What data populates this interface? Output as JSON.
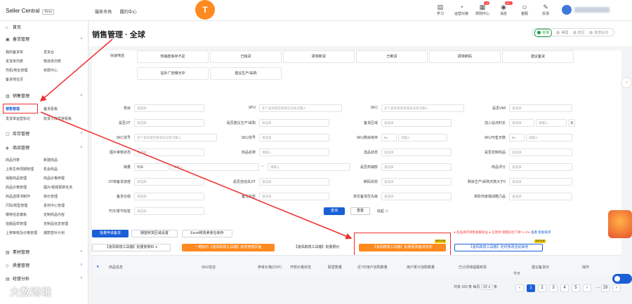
{
  "topbar": {
    "brand": "Seller Central",
    "beta": "Beta",
    "nav": [
      "服务市场",
      "履约中心"
    ],
    "logo_glyph": "T",
    "icons": [
      {
        "label": "学习",
        "icon": "book-icon",
        "glyph": "▤",
        "badge": ""
      },
      {
        "label": "运营对接",
        "icon": "headset-icon",
        "glyph": "◔",
        "badge": ""
      },
      {
        "label": "规则中心",
        "icon": "rules-icon",
        "glyph": "▦",
        "badge": "12"
      },
      {
        "label": "消息",
        "icon": "bell-icon",
        "glyph": "◉",
        "badge": "99+"
      },
      {
        "label": "客服",
        "icon": "service-icon",
        "glyph": "☺",
        "badge": ""
      },
      {
        "label": "反馈",
        "icon": "feedback-icon",
        "glyph": "✎",
        "badge": ""
      }
    ]
  },
  "sidebar": {
    "home": "首页",
    "groups": [
      {
        "label": "备货管理",
        "items": [
          "我的备货单",
          "发货台",
          "发货单列表",
          "物流单列表",
          "司机/地址管理",
          "权限中心",
          "备货地址页"
        ]
      },
      {
        "label": "销售管理",
        "items": [
          "销售管理",
          "备货看板",
          "发货单运营标记",
          "收货入库异常看板"
        ]
      },
      {
        "label": "库存管理",
        "items": []
      },
      {
        "label": "商品管理",
        "items": [
          "商品列表",
          "新建商品",
          "上新生命周期管理",
          "机会商品",
          "保税商品管理",
          "商品价格申报",
          "商品价格管理",
          "图片/视频更新任务",
          "商品选择书制作",
          "核价管理",
          "尺码/规型管理",
          "素材中心管理",
          "模特信息模板",
          "定制商品内容",
          "拍摄品样管理",
          "定制品信息管理",
          "上架审核及价格管理",
          "爆款替补计划"
        ]
      },
      {
        "label": "素材管理",
        "items": []
      },
      {
        "label": "质量管理",
        "items": []
      },
      {
        "label": "经营分析",
        "items": []
      }
    ]
  },
  "watermark": "大数跨境",
  "page": {
    "title": "销售管理 · 全球",
    "site_toggle": [
      "全球",
      "美国",
      "欧区",
      "其他站点"
    ]
  },
  "quick_filter": {
    "label": "快速筛选",
    "row1": [
      "热销款库存不足",
      "已缺货",
      "即将断货",
      "已断货",
      "即将断码",
      "建议备货"
    ],
    "row2": [
      "站外广告曝光中",
      "建议生产/采购"
    ]
  },
  "filters": {
    "row1": [
      {
        "label": "类目",
        "value": "请选择"
      },
      {
        "label": "SPU",
        "value": "多个查询请空格或逗号依次输入"
      },
      {
        "label": "SKC",
        "value": "多个查询请空格或逗号依次输入"
      },
      {
        "label": "是否VMI",
        "value": "请选择"
      }
    ],
    "row2": [
      {
        "label": "是否JIT",
        "value": "请选择"
      },
      {
        "label": "是否建议生产/采购",
        "value": "请选择"
      },
      {
        "label": "备货区域",
        "value": "请选择"
      },
      {
        "label": "加入站点时长",
        "value": "请选择",
        "extra": "请输入",
        "unit": "天"
      }
    ],
    "row3": [
      {
        "label": "SKC货号",
        "value": "多个查询请空格或逗号依次输入"
      },
      {
        "label": "SKU货号",
        "value": "请选择"
      },
      {
        "label": "SKU剩余库存",
        "prefix": "<=",
        "value": "请输入"
      },
      {
        "label": "SKU可售天数",
        "prefix": "<=",
        "value": "请输入"
      }
    ],
    "row4": [
      {
        "label": "图片审核状态",
        "value": "请选择"
      },
      {
        "label": "商品名称",
        "value": "请输入"
      },
      {
        "label": "选品状态",
        "value": "请选择"
      },
      {
        "label": "是否定制商品",
        "value": "请选择"
      }
    ],
    "row5": [
      {
        "label": "销量",
        "select": "今日",
        "value": "请输入",
        "tilde": "~",
        "value2": "请输入"
      },
      {
        "label": "是否热销款",
        "value": "请选择"
      },
      {
        "label": "商品评分",
        "value": "请选择"
      }
    ],
    "row6": [
      {
        "label": "JIT转备货进度",
        "value": "请选择"
      },
      {
        "label": "是否自动关JIT",
        "value": "请选择"
      },
      {
        "label": "断码状态",
        "value": "请选择"
      },
      {
        "label": "剩余生产/采购天数大于0",
        "value": "请选择"
      }
    ],
    "row7": [
      {
        "label": "备货仓组",
        "value": "请选择"
      },
      {
        "label": "备注状态",
        "value": "请选择"
      },
      {
        "label": "高优备货优先级",
        "value": "请选择"
      },
      {
        "label": "高阶商家端战略力品",
        "value": "请选择"
      }
    ],
    "row8": [
      {
        "label": "节日/季节标签",
        "value": "请选择"
      }
    ],
    "query": "查询",
    "reset": "重置",
    "collapse": "收起 ∧"
  },
  "toolbar": {
    "row1": [
      "批量申请备货",
      "期望到货区域设置",
      "Excel修改卖家仓库存"
    ],
    "row2": [
      {
        "label": "【凌风跨境工具箱】批量复制ID ∨",
        "style": "plain"
      },
      {
        "label": "一键加价【凌风跨境工具箱】航发管理页面",
        "style": "orange"
      },
      {
        "label": "【凌风跨境工具箱】批量限价",
        "style": "plain"
      },
      {
        "label": "【凌风跨境工具箱】批量更改备货状态",
        "style": "orange",
        "tag": "迷你页面"
      },
      {
        "label": "【凌风跨境工具箱】定时修改活动库存",
        "style": "outline",
        "tag": "迷你页面"
      }
    ],
    "legend": {
      "a": "● 商品库存销售报警权益",
      "b": "● 已暂停",
      "b_note": "销量同比下降 1~3%",
      "view": "查看",
      "sort": "智能排序"
    }
  },
  "table": {
    "headers": [
      "商品信息",
      "SKU信息",
      "参考价格(CNY)",
      "开款价格状态",
      "联营数量",
      "近7日用户加购数量",
      "用户累计加购数量",
      "已订阅待提醒到货",
      "今日",
      "建议备货日",
      "操作"
    ],
    "star": "★"
  },
  "pagination": {
    "total": "共有 183 条",
    "per_page_label": "每页",
    "per_page": "10 ∨",
    "unit": "条",
    "pages": [
      "‹",
      "1",
      "2",
      "3",
      "4",
      "5",
      "›",
      "…",
      "29",
      "›"
    ]
  }
}
